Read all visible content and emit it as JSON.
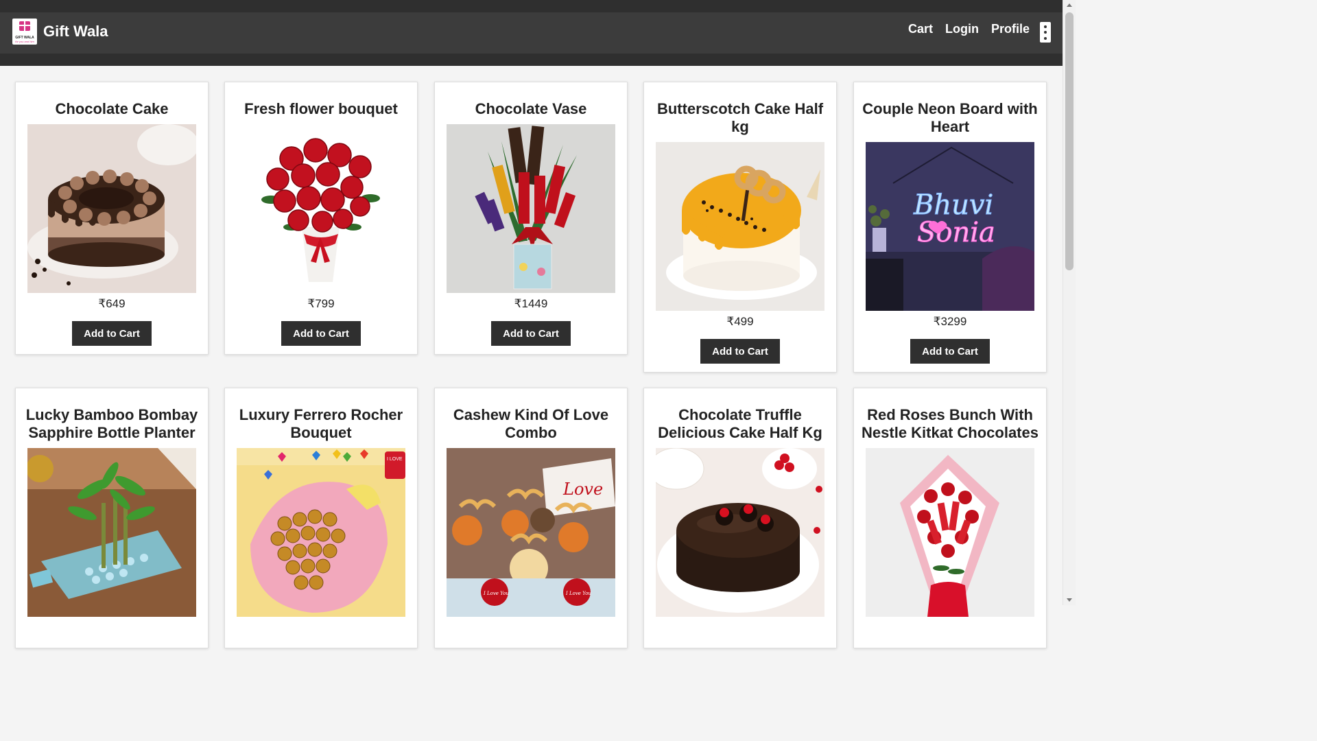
{
  "header": {
    "brand_name": "Gift Wala",
    "logo_text": "GIFT WALA",
    "logo_tagline": "for you and him",
    "nav": [
      "Cart",
      "Login",
      "Profile"
    ],
    "menu_icon": "kebab-menu-icon"
  },
  "products": [
    {
      "title": "Chocolate Cake",
      "price": "₹649",
      "button": "Add to Cart"
    },
    {
      "title": "Fresh flower bouquet",
      "price": "₹799",
      "button": "Add to Cart"
    },
    {
      "title": "Chocolate Vase",
      "price": "₹1449",
      "button": "Add to Cart"
    },
    {
      "title": "Butterscotch Cake Half kg",
      "price": "₹499",
      "button": "Add to Cart"
    },
    {
      "title": "Couple Neon Board with Heart",
      "price": "₹3299",
      "button": "Add to Cart",
      "neon_text_1": "Bhuvi",
      "neon_text_2": "Sonia"
    },
    {
      "title": "Lucky Bamboo Bombay Sapphire Bottle Planter"
    },
    {
      "title": "Luxury Ferrero Rocher Bouquet",
      "tag_text": "I LOVE"
    },
    {
      "title": "Cashew Kind Of Love Combo",
      "card_text": "Love",
      "tin_text": "I Love You"
    },
    {
      "title": "Chocolate Truffle Delicious Cake Half Kg"
    },
    {
      "title": "Red Roses Bunch With Nestle Kitkat Chocolates"
    }
  ]
}
